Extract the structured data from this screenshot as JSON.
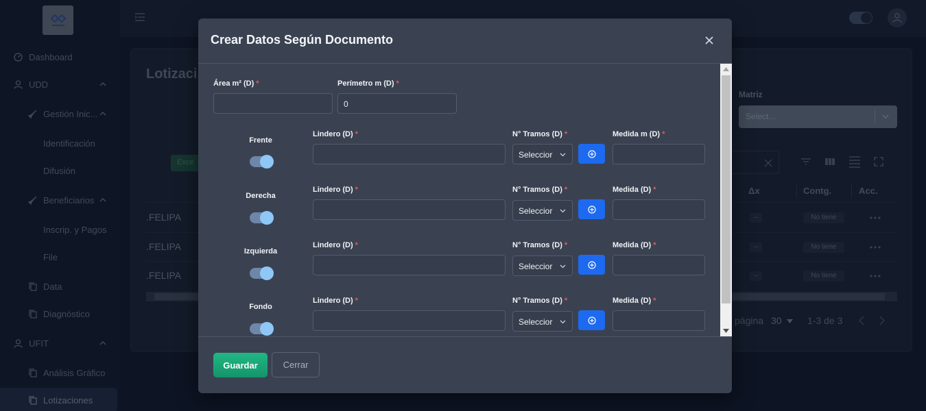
{
  "sidebar": {
    "items": [
      {
        "label": "Dashboard"
      },
      {
        "label": "UDD"
      },
      {
        "label": "Gestión Inic..."
      },
      {
        "label": "Identificación"
      },
      {
        "label": "Difusión"
      },
      {
        "label": "Beneficiarios"
      },
      {
        "label": "Inscrip. y Pagos"
      },
      {
        "label": "File"
      },
      {
        "label": "Data"
      },
      {
        "label": "Diagnóstico"
      },
      {
        "label": "UFIT"
      },
      {
        "label": "Análisis Gráfico"
      },
      {
        "label": "Lotizaciones"
      }
    ]
  },
  "page": {
    "title": "Lotizaci",
    "matriz_label": "Matriz",
    "matriz_placeholder": "Select...",
    "excel_label": "Exce",
    "columns": [
      "Δx",
      "Contg.",
      "Acc."
    ],
    "rows": [
      {
        "name": ".FELIPA",
        "dash": "--",
        "badge": "No tiene"
      },
      {
        "name": ".FELIPA",
        "dash": "--",
        "badge": "No tiene"
      },
      {
        "name": ".FELIPA",
        "dash": "--",
        "badge": "No tiene"
      }
    ],
    "pager": {
      "per_page_label": "página",
      "per_page": "30",
      "range": "1-3 de 3"
    }
  },
  "modal": {
    "title": "Crear Datos Según Documento",
    "area_label": "Área m² (D)",
    "area_value": "",
    "perimetro_label": "Perímetro m (D)",
    "perimetro_value": "0",
    "sides": [
      {
        "name": "Frente",
        "lindero_label": "Lindero (D)",
        "tramos_label": "N° Tramos (D)",
        "tramos_value": "Seleccior",
        "medida_label": "Medida m (D)",
        "lindero_value": "",
        "medida_value": ""
      },
      {
        "name": "Derecha",
        "lindero_label": "Lindero (D)",
        "tramos_label": "N° Tramos (D)",
        "tramos_value": "Seleccior",
        "medida_label": "Medida (D)",
        "lindero_value": "",
        "medida_value": ""
      },
      {
        "name": "Izquierda",
        "lindero_label": "Lindero (D)",
        "tramos_label": "N° Tramos (D)",
        "tramos_value": "Seleccior",
        "medida_label": "Medida (D)",
        "lindero_value": "",
        "medida_value": ""
      },
      {
        "name": "Fondo",
        "lindero_label": "Lindero (D)",
        "tramos_label": "N° Tramos (D)",
        "tramos_value": "Seleccior",
        "medida_label": "Medida (D)",
        "lindero_value": "",
        "medida_value": ""
      }
    ],
    "save_label": "Guardar",
    "cancel_label": "Cerrar"
  },
  "colors": {
    "accent_blue": "#1d6af0",
    "save_green": "#1ba779",
    "required_red": "#e45b5b",
    "modal_bg": "#3a4252",
    "page_bg": "#101828"
  }
}
